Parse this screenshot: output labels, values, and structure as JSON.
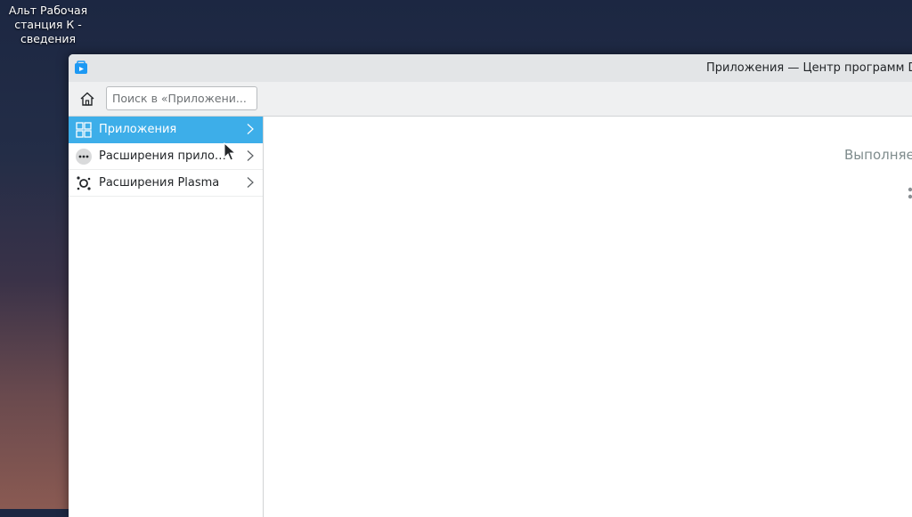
{
  "desktop": {
    "icon_label": "Альт Рабочая станция К  - сведения"
  },
  "window": {
    "title": "Приложения — Центр программ Di"
  },
  "toolbar": {
    "home_icon": "home-icon",
    "search_placeholder": "Поиск в «Приложени..."
  },
  "sidebar": {
    "items": [
      {
        "label": "Приложения",
        "icon": "grid-icon",
        "active": true
      },
      {
        "label": "Расширения прилож...",
        "icon": "more-dots-icon",
        "active": false
      },
      {
        "label": "Расширения Plasma",
        "icon": "plasma-icon",
        "active": false
      }
    ]
  },
  "content": {
    "status": "Выполняе"
  },
  "colors": {
    "accent": "#3daee9",
    "titlebar": "#e3e5e7",
    "toolbar": "#eff0f1"
  }
}
